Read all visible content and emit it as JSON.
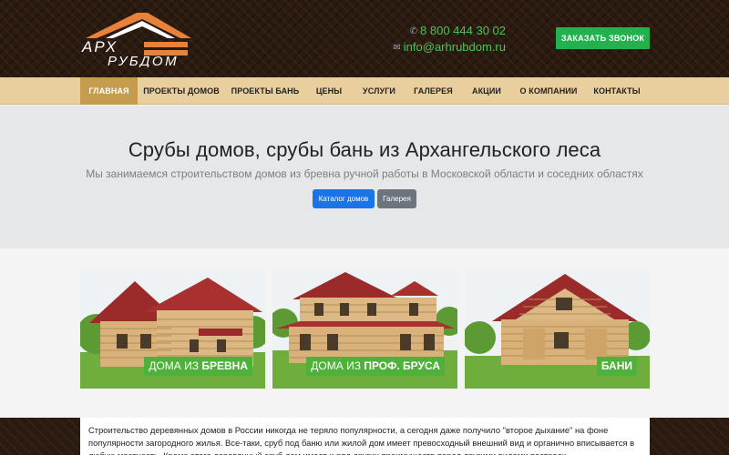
{
  "header": {
    "logo": {
      "line1": "АРХ",
      "line2": "РУБДОМ"
    },
    "phone": "8 800 444 30 02",
    "email": "info@arhrubdom.ru",
    "call_button": "ЗАКАЗАТЬ ЗВОНОК",
    "icons": {
      "phone": "phone-icon",
      "email": "envelope-icon"
    }
  },
  "nav": {
    "items": [
      {
        "label": "ГЛАВНАЯ",
        "active": true
      },
      {
        "label": "ПРОЕКТЫ ДОМОВ",
        "active": false
      },
      {
        "label": "ПРОЕКТЫ БАНЬ",
        "active": false
      },
      {
        "label": "ЦЕНЫ",
        "active": false
      },
      {
        "label": "УСЛУГИ",
        "active": false
      },
      {
        "label": "ГАЛЕРЕЯ",
        "active": false
      },
      {
        "label": "АКЦИИ",
        "active": false
      },
      {
        "label": "О КОМПАНИИ",
        "active": false
      },
      {
        "label": "КОНТАКТЫ",
        "active": false
      }
    ]
  },
  "hero": {
    "title": "Срубы домов, срубы бань из Архангельского леса",
    "subtitle": "Мы занимаемся строительством домов из бревна ручной работы в Московской области и соседних областях",
    "buttons": {
      "catalog": "Каталог домов",
      "gallery": "Галерея"
    }
  },
  "cards": [
    {
      "label_prefix": "ДОМА ИЗ ",
      "label_bold": "БРЕВНА"
    },
    {
      "label_prefix": "ДОМА ИЗ ",
      "label_bold": "ПРОФ. БРУСА"
    },
    {
      "label_prefix": "",
      "label_bold": "БАНИ"
    }
  ],
  "intro_text": "Строительство деревянных  домов в России никогда не теряло популярности, а сегодня даже получило \"второе дыхание\" на фоне популярности загородного жилья. Все-таки, сруб под баню или жилой дом имеет превосходный внешний вид и органично вписывается в любую местность. Кроме этого деревянный сруб дом имеет и ряд других преимуществ перед другими видами построек.",
  "colors": {
    "accent_green": "#22b14c",
    "label_green": "#4fb13c",
    "nav_bg": "#e9cf9d",
    "nav_active": "#c59c4e",
    "logo_orange": "#e8823b",
    "primary_blue": "#1a73e8",
    "secondary_gray": "#6c757d"
  }
}
